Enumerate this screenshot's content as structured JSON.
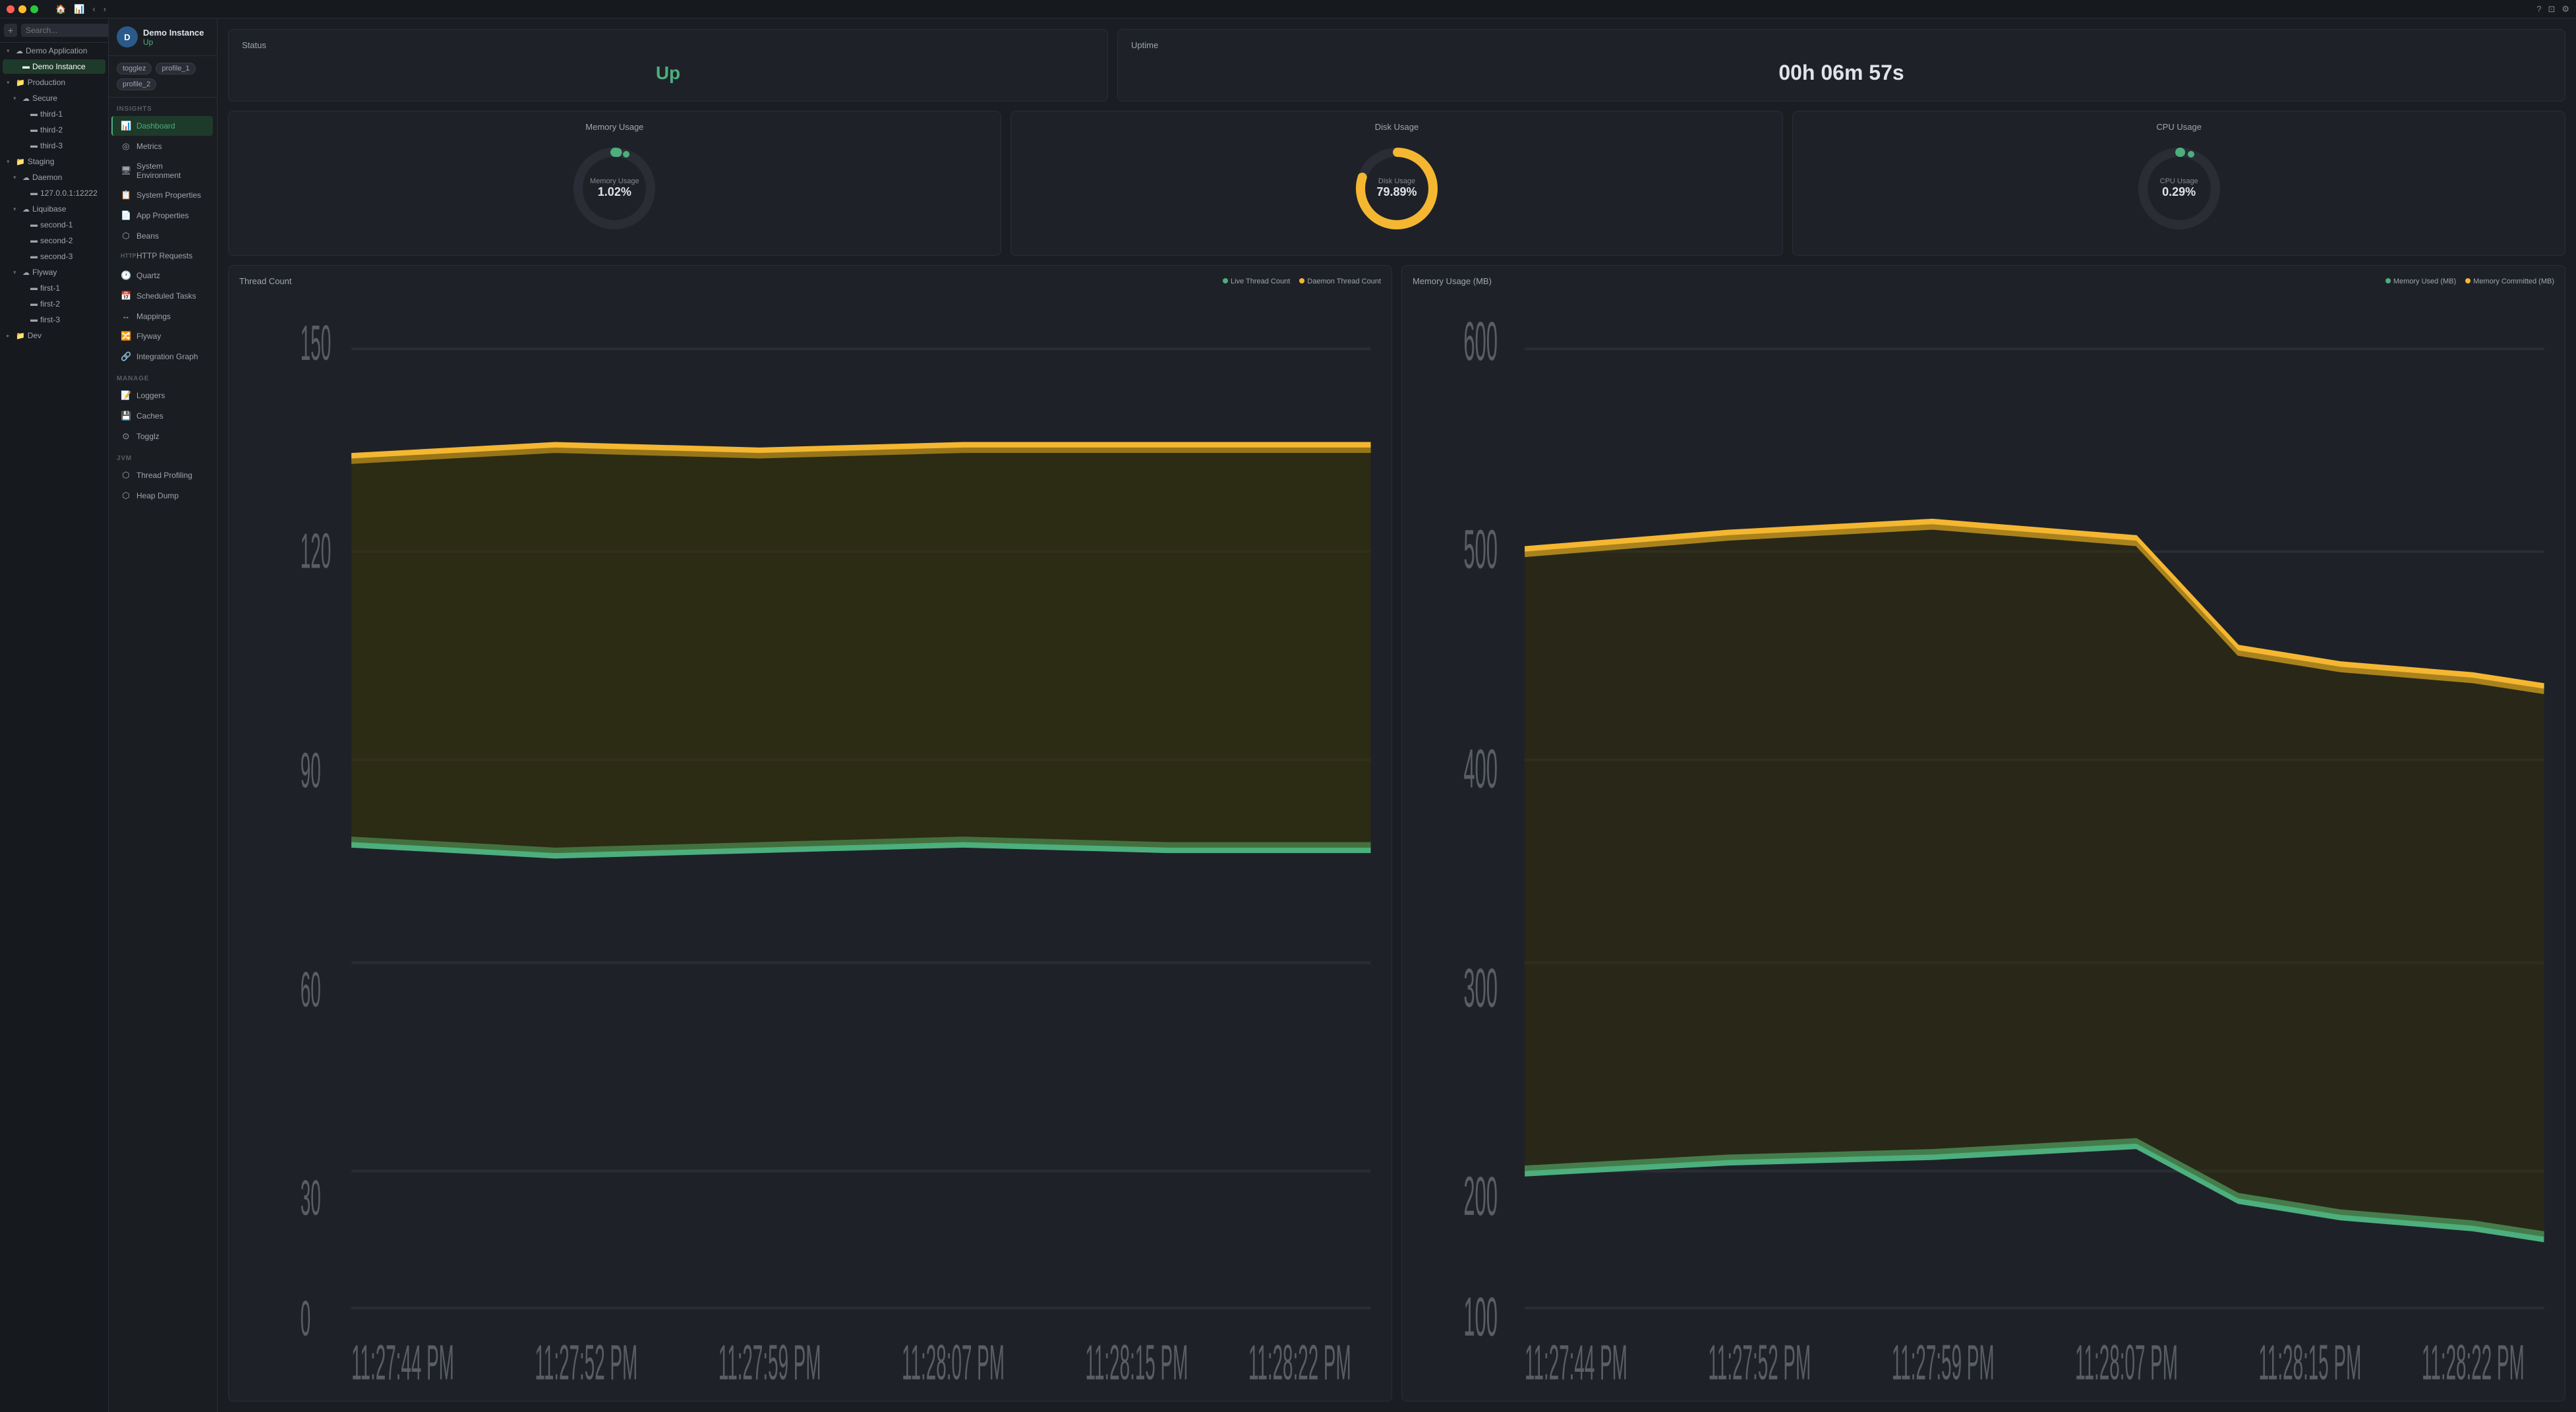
{
  "titlebar": {
    "nav_back": "‹",
    "nav_forward": "›",
    "help_icon": "?",
    "window_icon": "⊡",
    "settings_icon": "⚙"
  },
  "sidebar": {
    "search_placeholder": "Search...",
    "items": [
      {
        "id": "demo-application",
        "label": "Demo Application",
        "level": 0,
        "type": "cloud",
        "expanded": true
      },
      {
        "id": "demo-instance",
        "label": "Demo Instance",
        "level": 1,
        "type": "instance",
        "active": true
      },
      {
        "id": "production",
        "label": "Production",
        "level": 0,
        "type": "folder",
        "expanded": true
      },
      {
        "id": "secure",
        "label": "Secure",
        "level": 1,
        "type": "cloud",
        "expanded": true
      },
      {
        "id": "third-1",
        "label": "third-1",
        "level": 2,
        "type": "instance"
      },
      {
        "id": "third-2",
        "label": "third-2",
        "level": 2,
        "type": "instance"
      },
      {
        "id": "third-3",
        "label": "third-3",
        "level": 2,
        "type": "instance"
      },
      {
        "id": "staging",
        "label": "Staging",
        "level": 0,
        "type": "folder",
        "expanded": true
      },
      {
        "id": "daemon",
        "label": "Daemon",
        "level": 1,
        "type": "cloud",
        "expanded": true
      },
      {
        "id": "127-ip",
        "label": "127.0.0.1:12222",
        "level": 2,
        "type": "instance"
      },
      {
        "id": "liquibase",
        "label": "Liquibase",
        "level": 1,
        "type": "cloud",
        "expanded": true
      },
      {
        "id": "second-1",
        "label": "second-1",
        "level": 2,
        "type": "instance"
      },
      {
        "id": "second-2",
        "label": "second-2",
        "level": 2,
        "type": "instance"
      },
      {
        "id": "second-3",
        "label": "second-3",
        "level": 2,
        "type": "instance"
      },
      {
        "id": "flyway",
        "label": "Flyway",
        "level": 1,
        "type": "cloud",
        "expanded": true
      },
      {
        "id": "first-1",
        "label": "first-1",
        "level": 2,
        "type": "instance"
      },
      {
        "id": "first-2",
        "label": "first-2",
        "level": 2,
        "type": "instance"
      },
      {
        "id": "first-3",
        "label": "first-3",
        "level": 2,
        "type": "instance"
      },
      {
        "id": "dev",
        "label": "Dev",
        "level": 0,
        "type": "folder",
        "expanded": false
      }
    ]
  },
  "instance": {
    "name": "Demo Instance",
    "status": "Up",
    "avatar_letter": "D",
    "tags": [
      "togglez",
      "profile_1",
      "profile_2"
    ]
  },
  "nav": {
    "insights_label": "INSIGHTS",
    "manage_label": "MANAGE",
    "jvm_label": "JVM",
    "items_insights": [
      {
        "id": "dashboard",
        "label": "Dashboard",
        "icon": "📊",
        "active": true
      },
      {
        "id": "metrics",
        "label": "Metrics",
        "icon": "◎"
      },
      {
        "id": "system-env",
        "label": "System Environment",
        "icon": "🖥"
      },
      {
        "id": "system-props",
        "label": "System Properties",
        "icon": "📋"
      },
      {
        "id": "app-props",
        "label": "App Properties",
        "icon": "📄"
      },
      {
        "id": "beans",
        "label": "Beans",
        "icon": "⬡"
      },
      {
        "id": "http-requests",
        "label": "HTTP Requests",
        "icon": "HTTP"
      },
      {
        "id": "quartz",
        "label": "Quartz",
        "icon": "🕐"
      },
      {
        "id": "scheduled-tasks",
        "label": "Scheduled Tasks",
        "icon": "📅"
      },
      {
        "id": "mappings",
        "label": "Mappings",
        "icon": "↔"
      },
      {
        "id": "flyway",
        "label": "Flyway",
        "icon": "🔀"
      },
      {
        "id": "integration-graph",
        "label": "Integration Graph",
        "icon": "🔗"
      }
    ],
    "items_manage": [
      {
        "id": "loggers",
        "label": "Loggers",
        "icon": "📝"
      },
      {
        "id": "caches",
        "label": "Caches",
        "icon": "💾"
      },
      {
        "id": "togglz",
        "label": "Togglz",
        "icon": "⊙"
      }
    ],
    "items_jvm": [
      {
        "id": "thread-profiling",
        "label": "Thread Profiling",
        "icon": "⬡"
      },
      {
        "id": "heap-dump",
        "label": "Heap Dump",
        "icon": "⬡"
      }
    ]
  },
  "dashboard": {
    "status_title": "Status",
    "status_value": "Up",
    "uptime_title": "Uptime",
    "uptime_value": "00h 06m 57s",
    "memory_title": "Memory Usage",
    "memory_label": "Memory Usage",
    "memory_value": "1.02%",
    "disk_title": "Disk Usage",
    "disk_label": "Disk Usage",
    "disk_value": "79.89%",
    "cpu_title": "CPU Usage",
    "cpu_label": "CPU Usage",
    "cpu_value": "0.29%",
    "thread_count_title": "Thread Count",
    "legend_live_thread": "Live Thread Count",
    "legend_daemon_thread": "Daemon Thread Count",
    "memory_mb_title": "Memory Usage (MB)",
    "legend_memory_used": "Memory Used (MB)",
    "legend_memory_committed": "Memory Committed (MB)",
    "thread_y_labels": [
      "150",
      "120",
      "90",
      "60",
      "30",
      "0"
    ],
    "thread_x_labels": [
      "11:27:44 PM",
      "11:27:52 PM",
      "11:27:59 PM",
      "11:28:07 PM",
      "11:28:15 PM",
      "11:28:22 PM"
    ],
    "memory_mb_y_labels": [
      "600",
      "500",
      "400",
      "300",
      "200",
      "100"
    ],
    "memory_mb_x_labels": [
      "11:27:44 PM",
      "11:27:52 PM",
      "11:27:59 PM",
      "11:28:07 PM",
      "11:28:15 PM",
      "11:28:22 PM"
    ]
  },
  "colors": {
    "green": "#4caf7d",
    "yellow": "#f5b731",
    "bg_card": "#1e2228",
    "bg_sidebar": "#16191d",
    "border": "#2a2d35",
    "text_dim": "#a0a4ae",
    "text_bright": "#e0e4ea"
  }
}
